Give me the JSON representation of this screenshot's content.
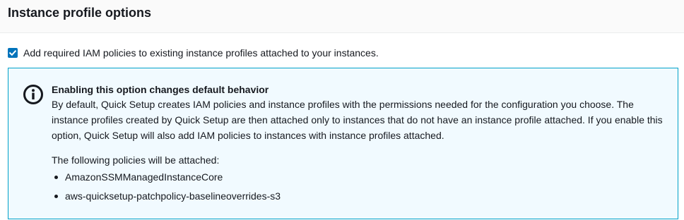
{
  "section": {
    "title": "Instance profile options"
  },
  "option": {
    "label": "Add required IAM policies to existing instance profiles attached to your instances.",
    "checked": true,
    "accent_color": "#0073bb"
  },
  "info": {
    "icon": "info-icon",
    "heading": "Enabling this option changes default behavior",
    "body": "By default, Quick Setup creates IAM policies and instance profiles with the permissions needed for the configuration you choose. The instance profiles created by Quick Setup are then attached only to instances that do not have an instance profile attached. If you enable this option, Quick Setup will also add IAM policies to instances with instance profiles attached.",
    "policies_intro": "The following policies will be attached:",
    "policies": [
      "AmazonSSMManagedInstanceCore",
      "aws-quicksetup-patchpolicy-baselineoverrides-s3"
    ],
    "border_color": "#00a1c9",
    "background_color": "#f1faff"
  }
}
